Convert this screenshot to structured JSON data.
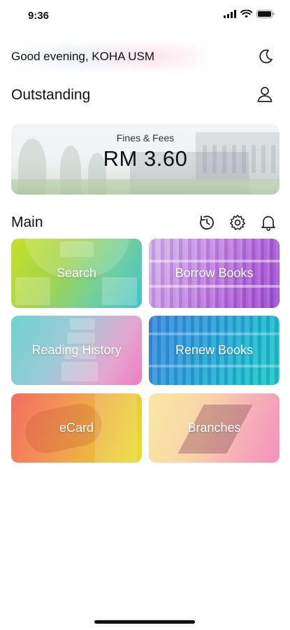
{
  "status_bar": {
    "time": "9:36",
    "icons": [
      "cellular-icon",
      "wifi-icon",
      "battery-icon"
    ]
  },
  "header": {
    "greeting": "Good evening, KOHA USM",
    "theme_icon": "moon-icon"
  },
  "outstanding": {
    "title": "Outstanding",
    "profile_icon": "user-icon",
    "card": {
      "label": "Fines & Fees",
      "amount": "RM 3.60"
    }
  },
  "main": {
    "title": "Main",
    "action_icons": [
      "history-icon",
      "settings-icon",
      "notification-bell-icon"
    ],
    "tiles": [
      {
        "label": "Search"
      },
      {
        "label": "Borrow Books"
      },
      {
        "label": "Reading History"
      },
      {
        "label": "Renew Books"
      },
      {
        "label": "eCard"
      },
      {
        "label": "Branches"
      }
    ]
  },
  "colors": {
    "text": "#111111",
    "background": "#ffffff",
    "tile_label": "#ffffff"
  }
}
